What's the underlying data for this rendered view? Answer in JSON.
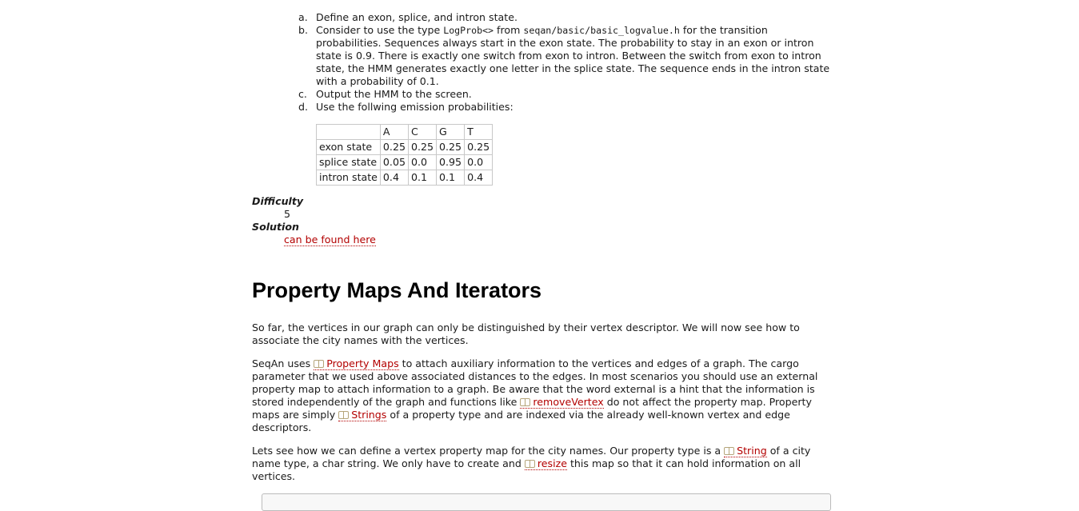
{
  "steps": [
    {
      "marker": "a.",
      "text": "Define an exon, splice, and intron state."
    },
    {
      "marker": "b.",
      "pre": "Consider to use the type ",
      "code1": "LogProb<>",
      "mid": " from ",
      "code2": "seqan/basic/basic_logvalue.h",
      "post": " for the transition probabilities. Sequences always start in the exon state. The probability to stay in an exon or intron state is 0.9. There is exactly one switch from exon to intron. Between the switch from exon to intron state, the HMM generates exactly one letter in the splice state. The sequence ends in the intron state with a probability of 0.1."
    },
    {
      "marker": "c.",
      "text": "Output the HMM to the screen."
    },
    {
      "marker": "d.",
      "text": "Use the follwing emission probabilities:"
    }
  ],
  "emission_table": {
    "header": [
      "",
      "A",
      "C",
      "G",
      "T"
    ],
    "rows": [
      [
        "exon state",
        "0.25",
        "0.25",
        "0.25",
        "0.25"
      ],
      [
        "splice state",
        "0.05",
        "0.0",
        "0.95",
        "0.0"
      ],
      [
        "intron state",
        "0.4",
        "0.1",
        "0.1",
        "0.4"
      ]
    ]
  },
  "difficulty": {
    "label": "Difficulty",
    "value": "5"
  },
  "solution": {
    "label": "Solution",
    "link": "can be found here"
  },
  "section": {
    "heading": "Property Maps And Iterators",
    "p1": "So far, the vertices in our graph can only be distinguished by their vertex descriptor. We will now see how to associate the city names with the vertices.",
    "p2": {
      "t1": "SeqAn uses ",
      "l1": "Property Maps",
      "t2": " to attach auxiliary information to the vertices and edges of a graph. The cargo parameter that we used above associated distances to the edges. In most scenarios you should use an external property map to attach information to a graph. Be aware that the word external is a hint that the information is stored independently of the graph and functions like ",
      "l2": "removeVertex",
      "t3": " do not affect the property map. Property maps are simply ",
      "l3": "Strings",
      "t4": " of a property type and are indexed via the already well-known vertex and edge descriptors."
    },
    "p3": {
      "t1": "Lets see how we can define a vertex property map for the city names. Our property type is a ",
      "l1": "String",
      "t2": " of a city name type, a char string. We only have to create and ",
      "l2": "resize",
      "t3": " this map so that it can hold information on all vertices."
    }
  }
}
